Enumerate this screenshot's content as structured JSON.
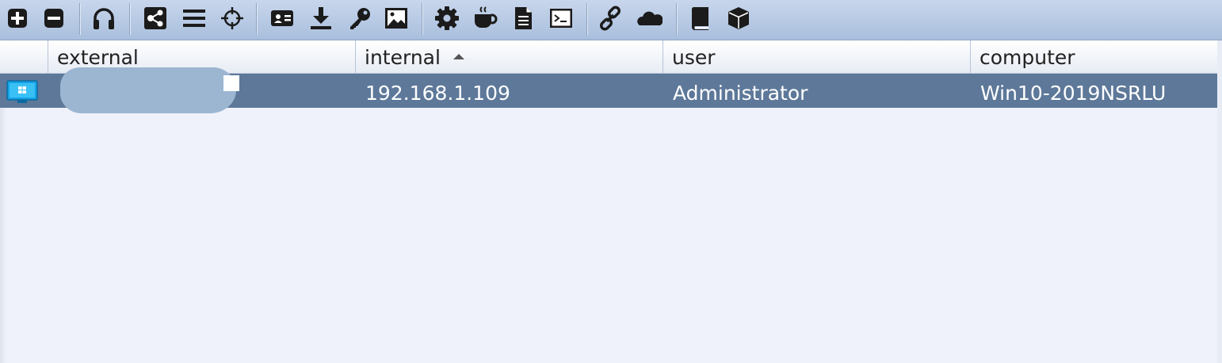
{
  "toolbar": {
    "buttons": [
      {
        "name": "add-icon"
      },
      {
        "name": "remove-icon"
      },
      {
        "name": "headphones-icon"
      },
      {
        "name": "pivot-graph-icon"
      },
      {
        "name": "list-icon"
      },
      {
        "name": "crosshair-icon"
      },
      {
        "name": "id-card-icon"
      },
      {
        "name": "download-icon"
      },
      {
        "name": "key-icon"
      },
      {
        "name": "image-icon"
      },
      {
        "name": "gear-icon"
      },
      {
        "name": "coffee-cup-icon"
      },
      {
        "name": "document-icon"
      },
      {
        "name": "terminal-icon"
      },
      {
        "name": "link-icon"
      },
      {
        "name": "cloud-icon"
      },
      {
        "name": "book-icon"
      },
      {
        "name": "cube-icon"
      }
    ]
  },
  "table": {
    "columns": [
      "external",
      "internal",
      "user",
      "computer"
    ],
    "sorted_column": "internal",
    "sort_direction": "ascending",
    "rows": [
      {
        "os_icon": "windows-icon",
        "external": "",
        "internal": "192.168.1.109",
        "user": "Administrator",
        "computer": "Win10-2019NSRLU",
        "selected": true
      }
    ]
  },
  "colors": {
    "toolbar_bg": "#b5c7e2",
    "selected_row": "#5d7899",
    "table_bg": "#eff2fa",
    "redaction": "#9cb6d2"
  }
}
